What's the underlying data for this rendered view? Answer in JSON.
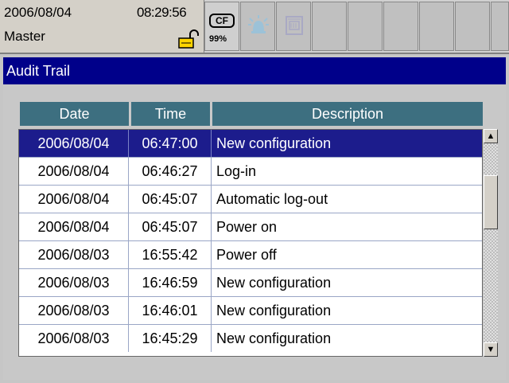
{
  "status": {
    "date": "2006/08/04",
    "time": "08:29:56",
    "user": "Master",
    "lock_icon": "padlock-open-icon",
    "cf_label": "CF",
    "cf_usage": "99%",
    "alarm_icon": "alarm-bell-icon",
    "memory_icon": "memory-module-icon"
  },
  "title": "Audit Trail",
  "table": {
    "columns": [
      "Date",
      "Time",
      "Description"
    ],
    "rows": [
      {
        "date": "2006/08/04",
        "time": "06:47:00",
        "desc": "New configuration"
      },
      {
        "date": "2006/08/04",
        "time": "06:46:27",
        "desc": "Log-in"
      },
      {
        "date": "2006/08/04",
        "time": "06:45:07",
        "desc": "Automatic log-out"
      },
      {
        "date": "2006/08/04",
        "time": "06:45:07",
        "desc": "Power on"
      },
      {
        "date": "2006/08/03",
        "time": "16:55:42",
        "desc": "Power off"
      },
      {
        "date": "2006/08/03",
        "time": "16:46:59",
        "desc": "New configuration"
      },
      {
        "date": "2006/08/03",
        "time": "16:46:01",
        "desc": "New configuration"
      },
      {
        "date": "2006/08/03",
        "time": "16:45:29",
        "desc": "New configuration"
      }
    ],
    "selected_index": 0
  },
  "scrollbar": {
    "up_arrow": "▲",
    "down_arrow": "▼"
  },
  "colors": {
    "title_bg": "#00008a",
    "header_bg": "#3d6f80",
    "selection_bg": "#1c1c8c"
  }
}
